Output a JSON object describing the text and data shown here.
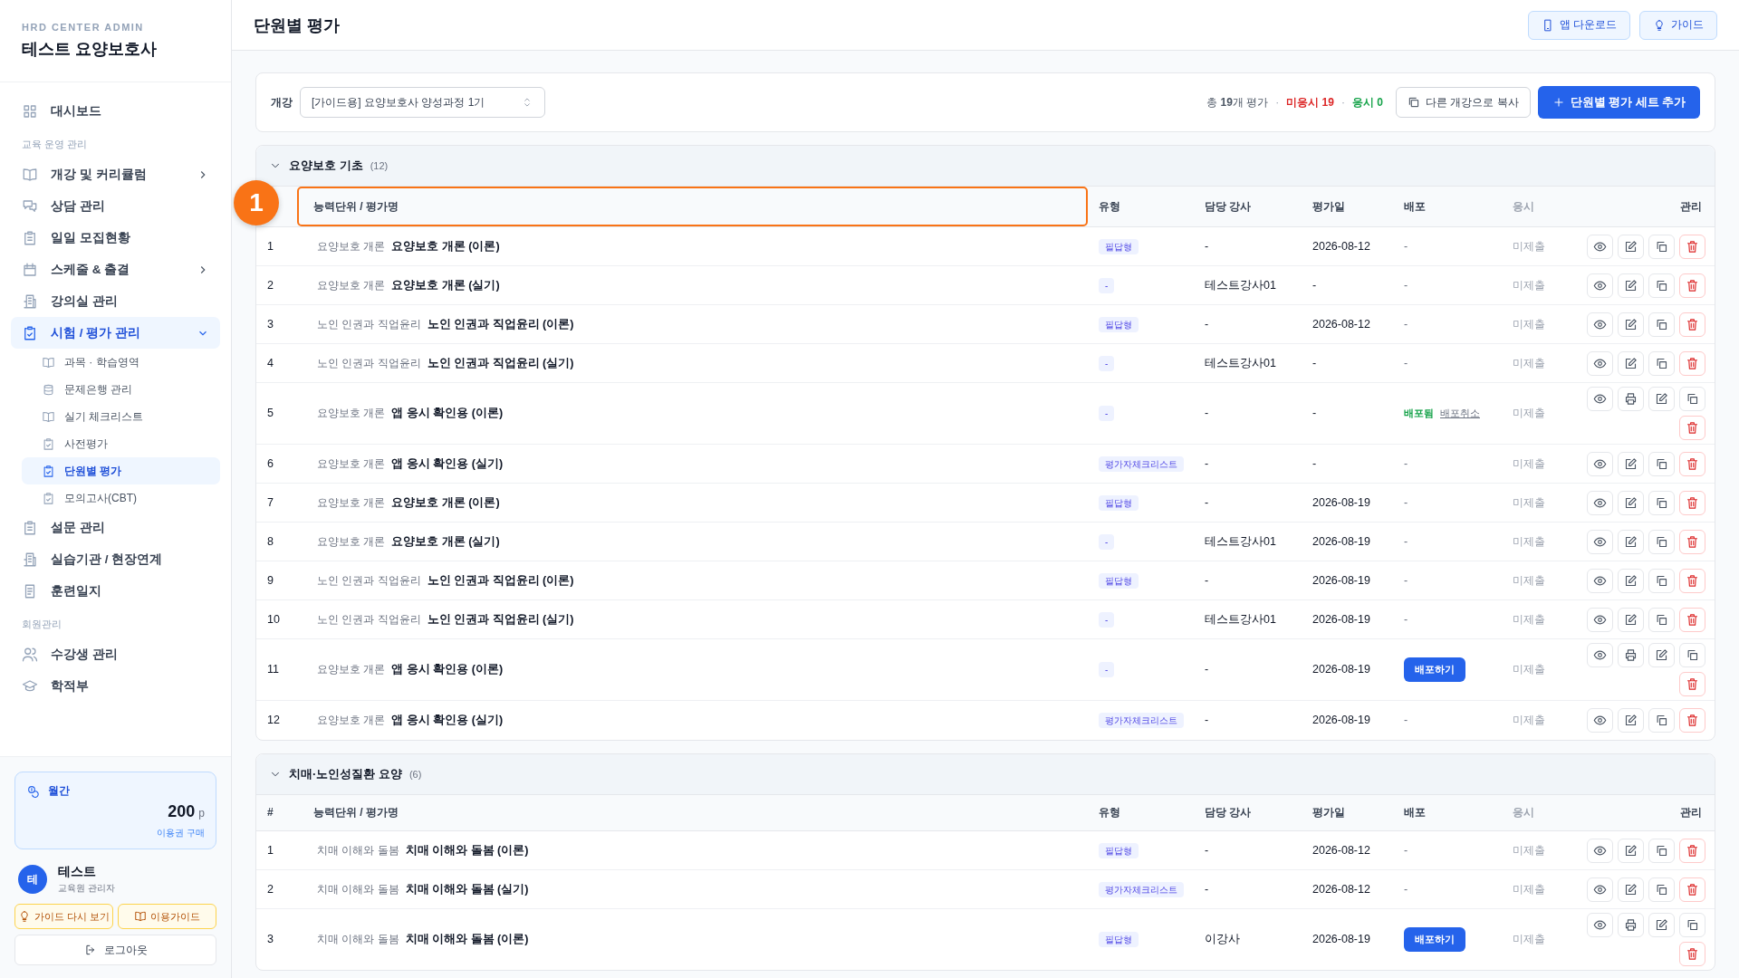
{
  "sidebar": {
    "org": "HRD CENTER ADMIN",
    "title": "테스트 요양보호사",
    "nav": [
      {
        "kind": "item",
        "label": "대시보드",
        "selected": false
      },
      {
        "kind": "section",
        "label": "교육 운영 관리"
      },
      {
        "kind": "item",
        "label": "개강 및 커리큘럼",
        "selected": false,
        "expanded": false
      },
      {
        "kind": "item",
        "label": "상담 관리",
        "selected": false
      },
      {
        "kind": "item",
        "label": "일일 모집현황",
        "selected": false
      },
      {
        "kind": "item",
        "label": "스케줄 & 출결",
        "selected": false,
        "expanded": false
      },
      {
        "kind": "item",
        "label": "강의실 관리",
        "selected": false
      },
      {
        "kind": "item",
        "label": "시험 / 평가 관리",
        "selected": true,
        "expanded": true,
        "children": [
          {
            "label": "과목 · 학습영역",
            "selected": false
          },
          {
            "label": "문제은행 관리",
            "selected": false
          },
          {
            "label": "실기 체크리스트",
            "selected": false
          },
          {
            "label": "사전평가",
            "selected": false
          },
          {
            "label": "단원별 평가",
            "selected": true
          },
          {
            "label": "모의고사(CBT)",
            "selected": false
          }
        ]
      },
      {
        "kind": "item",
        "label": "설문 관리",
        "selected": false
      },
      {
        "kind": "item",
        "label": "실습기관 / 현장연계",
        "selected": false
      },
      {
        "kind": "item",
        "label": "훈련일지",
        "selected": false
      },
      {
        "kind": "section",
        "label": "회원관리"
      },
      {
        "kind": "item",
        "label": "수강생 관리",
        "selected": false
      },
      {
        "kind": "item",
        "label": "학적부",
        "selected": false
      }
    ],
    "plan": {
      "label": "월간",
      "points": "200",
      "unit": "p",
      "link": "이용권 구매"
    },
    "user": {
      "initial": "테",
      "name": "테스트",
      "role": "교육원 관리자"
    },
    "guide_buttons": [
      "가이드 다시 보기",
      "이용가이드"
    ],
    "logout": "로그아웃"
  },
  "header": {
    "title": "단원별 평가",
    "buttons": [
      "앱 다운로드",
      "가이드"
    ]
  },
  "toolbar": {
    "label": "개강",
    "select": "[가이드용] 요양보호사 양성과정 1기",
    "summary": {
      "total": "총 **19**개 평가",
      "not_taken": "미응시 19",
      "taken": "응시 0",
      "separator": "·"
    },
    "copy_button": "다른 개강으로 복사",
    "add_button": "단원별 평가 세트 추가"
  },
  "groups": [
    {
      "title": "요양보호 기초",
      "count": "(12)",
      "expanded": true,
      "callout": "1",
      "columns": [
        {
          "kind": "index"
        },
        {
          "kind": "name",
          "label": "능력단위 / 평가명",
          "highlighted": true
        },
        {
          "kind": "type",
          "label": "유형"
        },
        {
          "kind": "teacher",
          "label": "담당 강사"
        },
        {
          "kind": "date",
          "label": "평가일"
        },
        {
          "kind": "deploy",
          "label": "배포"
        },
        {
          "kind": "status",
          "label": "응시"
        },
        {
          "kind": "actions",
          "label": "관리"
        }
      ],
      "rows": [
        {
          "no": "1",
          "unit": "요양보호 개론",
          "name": "요양보호 개론 (이론)",
          "type": "필답형",
          "teacher": "-",
          "date": "2026-08-12",
          "deploy": {
            "kind": "none",
            "text": "-"
          },
          "status": "미제출",
          "print": false
        },
        {
          "no": "2",
          "unit": "요양보호 개론",
          "name": "요양보호 개론 (실기)",
          "type": "-",
          "teacher": "테스트강사01",
          "date": "-",
          "deploy": {
            "kind": "none",
            "text": "-"
          },
          "status": "미제출",
          "print": false
        },
        {
          "no": "3",
          "unit": "노인 인권과 직업윤리",
          "name": "노인 인권과 직업윤리 (이론)",
          "type": "필답형",
          "teacher": "-",
          "date": "2026-08-12",
          "deploy": {
            "kind": "none",
            "text": "-"
          },
          "status": "미제출",
          "print": false
        },
        {
          "no": "4",
          "unit": "노인 인권과 직업윤리",
          "name": "노인 인권과 직업윤리 (실기)",
          "type": "-",
          "teacher": "테스트강사01",
          "date": "-",
          "deploy": {
            "kind": "none",
            "text": "-"
          },
          "status": "미제출",
          "print": false
        },
        {
          "no": "5",
          "unit": "요양보호 개론",
          "name": "앱 응시 확인용 (이론)",
          "type": "-",
          "teacher": "-",
          "date": "-",
          "deploy": {
            "kind": "deployed",
            "text": "배포됨",
            "link": "배포취소"
          },
          "status": "미제출",
          "print": true
        },
        {
          "no": "6",
          "unit": "요양보호 개론",
          "name": "앱 응시 확인용 (실기)",
          "type": "평가자체크리스트",
          "teacher": "-",
          "date": "-",
          "deploy": {
            "kind": "none",
            "text": "-"
          },
          "status": "미제출",
          "print": false
        },
        {
          "no": "7",
          "unit": "요양보호 개론",
          "name": "요양보호 개론 (이론)",
          "type": "필답형",
          "teacher": "-",
          "date": "2026-08-19",
          "deploy": {
            "kind": "none",
            "text": "-"
          },
          "status": "미제출",
          "print": false
        },
        {
          "no": "8",
          "unit": "요양보호 개론",
          "name": "요양보호 개론 (실기)",
          "type": "-",
          "teacher": "테스트강사01",
          "date": "2026-08-19",
          "deploy": {
            "kind": "none",
            "text": "-"
          },
          "status": "미제출",
          "print": false
        },
        {
          "no": "9",
          "unit": "노인 인권과 직업윤리",
          "name": "노인 인권과 직업윤리 (이론)",
          "type": "필답형",
          "teacher": "-",
          "date": "2026-08-19",
          "deploy": {
            "kind": "none",
            "text": "-"
          },
          "status": "미제출",
          "print": false
        },
        {
          "no": "10",
          "unit": "노인 인권과 직업윤리",
          "name": "노인 인권과 직업윤리 (실기)",
          "type": "-",
          "teacher": "테스트강사01",
          "date": "2026-08-19",
          "deploy": {
            "kind": "none",
            "text": "-"
          },
          "status": "미제출",
          "print": false
        },
        {
          "no": "11",
          "unit": "요양보호 개론",
          "name": "앱 응시 확인용 (이론)",
          "type": "-",
          "teacher": "-",
          "date": "2026-08-19",
          "deploy": {
            "kind": "button",
            "text": "배포하기"
          },
          "status": "미제출",
          "print": true
        },
        {
          "no": "12",
          "unit": "요양보호 개론",
          "name": "앱 응시 확인용 (실기)",
          "type": "평가자체크리스트",
          "teacher": "-",
          "date": "2026-08-19",
          "deploy": {
            "kind": "none",
            "text": "-"
          },
          "status": "미제출",
          "print": false
        }
      ]
    },
    {
      "title": "치매·노인성질환 요양",
      "count": "(6)",
      "expanded": true,
      "columns": [
        {
          "kind": "index",
          "label": "#"
        },
        {
          "kind": "name",
          "label": "능력단위 / 평가명",
          "highlighted": false
        },
        {
          "kind": "type",
          "label": "유형"
        },
        {
          "kind": "teacher",
          "label": "담당 강사"
        },
        {
          "kind": "date",
          "label": "평가일"
        },
        {
          "kind": "deploy",
          "label": "배포"
        },
        {
          "kind": "status",
          "label": "응시"
        },
        {
          "kind": "actions",
          "label": "관리"
        }
      ],
      "rows": [
        {
          "no": "1",
          "unit": "치매 이해와 돌봄",
          "name": "치매 이해와 돌봄 (이론)",
          "type": "필답형",
          "teacher": "-",
          "date": "2026-08-12",
          "deploy": {
            "kind": "none",
            "text": "-"
          },
          "status": "미제출",
          "print": false
        },
        {
          "no": "2",
          "unit": "치매 이해와 돌봄",
          "name": "치매 이해와 돌봄 (실기)",
          "type": "평가자체크리스트",
          "teacher": "-",
          "date": "2026-08-12",
          "deploy": {
            "kind": "none",
            "text": "-"
          },
          "status": "미제출",
          "print": false
        },
        {
          "no": "3",
          "unit": "치매 이해와 돌봄",
          "name": "치매 이해와 돌봄 (이론)",
          "type": "필답형",
          "teacher": "이강사",
          "date": "2026-08-19",
          "deploy": {
            "kind": "button",
            "text": "배포하기"
          },
          "status": "미제출",
          "print": true
        }
      ]
    }
  ]
}
